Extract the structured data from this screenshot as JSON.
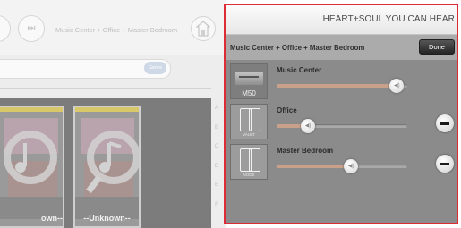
{
  "background_app": {
    "next_button_symbol": "⏭",
    "rooms_label": "Music Center + Office  + Master Bedroom",
    "genre_button": "Genre",
    "alpha_index": [
      "A",
      "B",
      "C",
      "D",
      "E",
      "F"
    ],
    "tiles": [
      {
        "caption": "own--"
      },
      {
        "caption": "--Unknown--"
      }
    ]
  },
  "panel": {
    "brand": "HEART+SOUL YOU CAN HEAR",
    "group_title": "Music Center + Office  + Master Bedroom",
    "done_label": "Done",
    "rooms": [
      {
        "name": "Music Center",
        "icon": "m50-speaker-icon",
        "icon_caption": "M50",
        "volume": 0.92,
        "removable": false
      },
      {
        "name": "Office",
        "icon": "vault-icon",
        "icon_caption": "VAULT",
        "volume": 0.24,
        "removable": true
      },
      {
        "name": "Master Bedroom",
        "icon": "node-icon",
        "icon_caption": "NODE",
        "volume": 0.57,
        "removable": true
      }
    ]
  },
  "colors": {
    "highlight_border": "#dc2c36",
    "volume_fill": "#c9a08a"
  }
}
